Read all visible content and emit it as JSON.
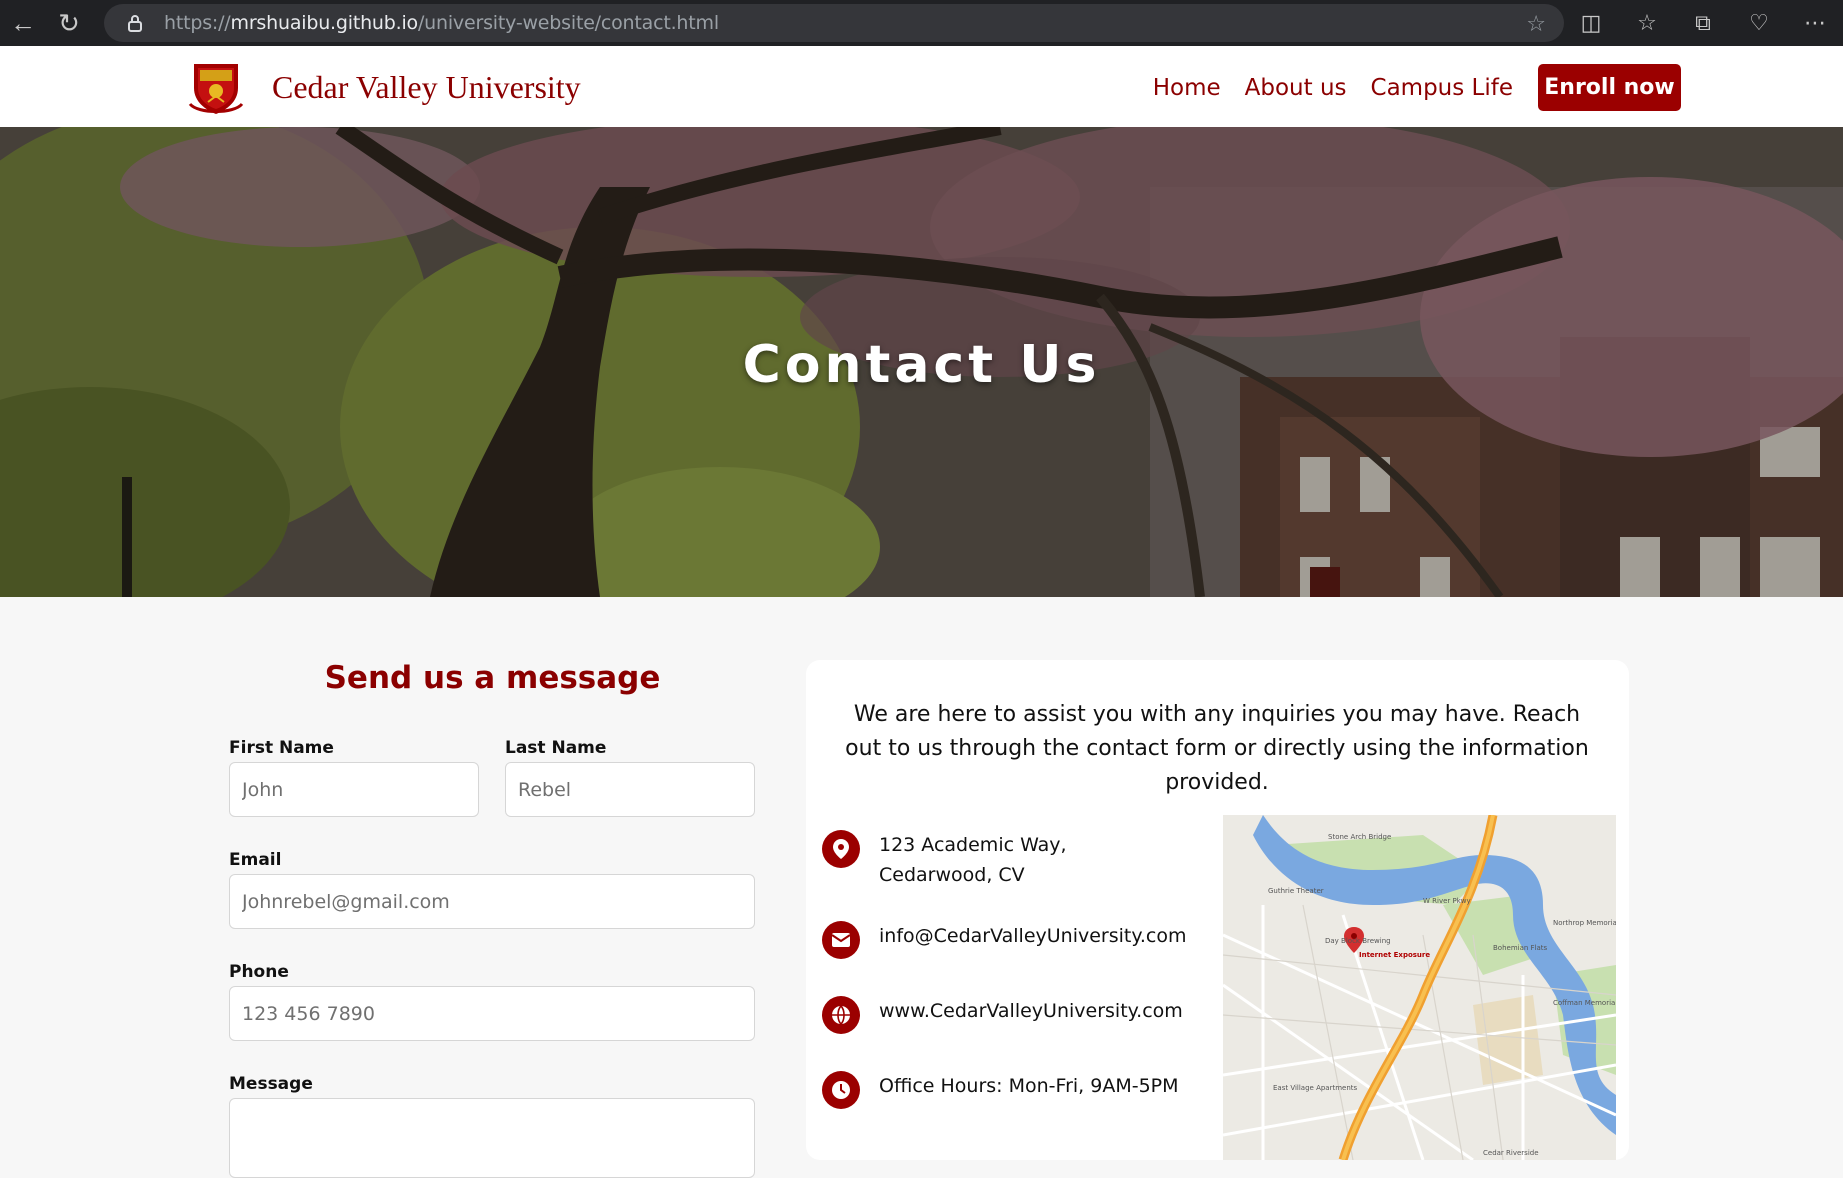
{
  "browser": {
    "url_prefix": "https://",
    "url_host": "mrshuaibu.github.io",
    "url_path": "/university-website/contact.html"
  },
  "header": {
    "brand_name": "Cedar Valley University",
    "nav": [
      "Home",
      "About us",
      "Campus Life"
    ],
    "enroll_label": "Enroll now"
  },
  "hero": {
    "title": "Contact Us"
  },
  "form": {
    "heading": "Send us a message",
    "first_name_label": "First Name",
    "first_name_placeholder": "John",
    "last_name_label": "Last Name",
    "last_name_placeholder": "Rebel",
    "email_label": "Email",
    "email_placeholder": "Johnrebel@gmail.com",
    "phone_label": "Phone",
    "phone_placeholder": "123 456 7890",
    "message_label": "Message"
  },
  "info": {
    "intro": "We are here to assist you with any inquiries you may have. Reach out to us through the contact form or directly using the information provided.",
    "address": "123 Academic Way, Cedarwood, CV",
    "email": "info@CedarValleyUniversity.com",
    "website": "www.CedarValleyUniversity.com",
    "hours": "Office Hours: Mon-Fri, 9AM-5PM"
  },
  "map": {
    "labels": [
      "Stone Arch Bridge",
      "Guthrie Theater",
      "W River Pkwy",
      "Day Block Brewing",
      "Internet Exposure",
      "Bohemian Flats",
      "Northrop Memorial Auditorium",
      "Coffman Memorial Union",
      "East Village Apartments",
      "Cedar Riverside"
    ],
    "marker": "Internet Exposure"
  },
  "colors": {
    "brand": "#8b0000",
    "button": "#9b0000"
  }
}
